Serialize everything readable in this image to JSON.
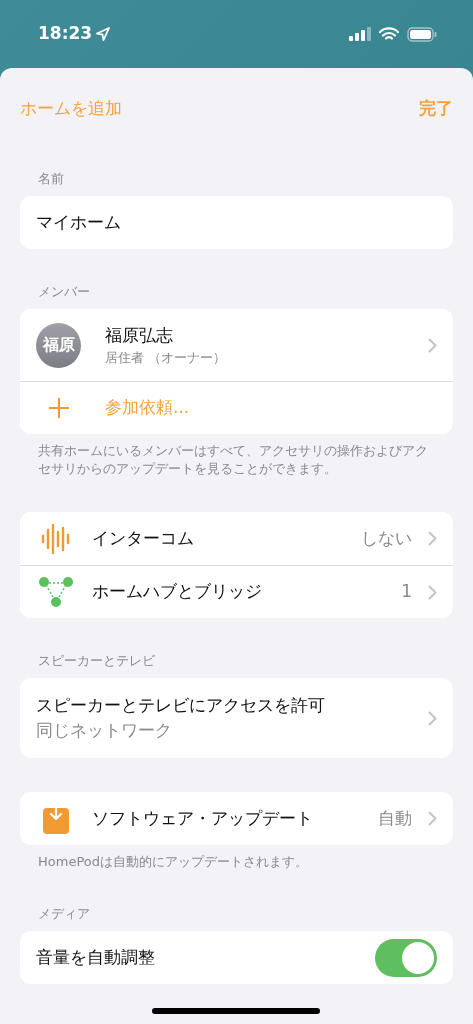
{
  "status_bar": {
    "time": "18:23"
  },
  "nav": {
    "left": "ホームを追加",
    "right": "完了"
  },
  "sections": [
    {
      "header": "名前",
      "kind": "field",
      "value": "マイホーム"
    },
    {
      "header": "メンバー",
      "kind": "members",
      "members": [
        {
          "initials": "福原",
          "name": "福原弘志",
          "role": "居住者 （オーナー）"
        }
      ],
      "invite": "参加依頼...",
      "footer": "共有ホームにいるメンバーはすべて、アクセサリの操作およびアクセサリからのアップデートを見ることができます。"
    },
    {
      "kind": "rows",
      "rows": [
        {
          "kind": "intercom",
          "label": "インターコム",
          "detail": "しない"
        },
        {
          "kind": "hub",
          "label": "ホームハブとブリッジ",
          "detail": "1"
        }
      ]
    },
    {
      "header": "スピーカーとテレビ",
      "kind": "rows",
      "rows": [
        {
          "kind": "plain",
          "label": "スピーカーとテレビにアクセスを許可",
          "subtitle": "同じネットワーク"
        }
      ]
    },
    {
      "kind": "rows",
      "rows": [
        {
          "kind": "update",
          "label": "ソフトウェア・アップデート",
          "detail": "自動"
        }
      ],
      "footer": "HomePodは自動的にアップデートされます。"
    },
    {
      "header": "メディア",
      "kind": "rows",
      "rows": [
        {
          "kind": "toggle",
          "label": "音量を自動調整",
          "on": true
        }
      ]
    }
  ]
}
